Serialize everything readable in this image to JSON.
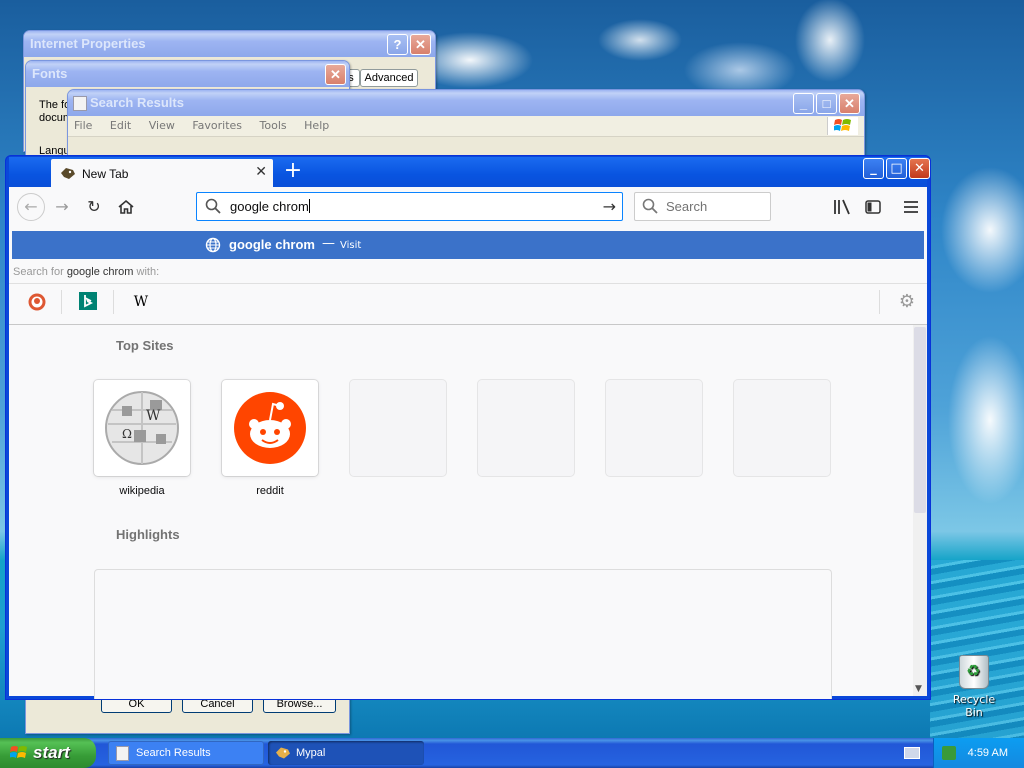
{
  "desktop": {
    "recycle_bin_label": "Recycle Bin"
  },
  "internet_properties": {
    "title": "Internet Properties",
    "tab_partial": "s",
    "tab_advanced": "Advanced"
  },
  "fonts_dialog": {
    "title": "Fonts",
    "text_line1": "The fo",
    "text_line2": "docum",
    "text_line3": "Langu",
    "ok_label": "OK",
    "cancel_label": "Cancel",
    "browse_label": "Browse..."
  },
  "search_results": {
    "title": "Search Results",
    "menu": [
      "File",
      "Edit",
      "View",
      "Favorites",
      "Tools",
      "Help"
    ]
  },
  "firefox": {
    "tab_title": "New Tab",
    "tab_close": "✕",
    "new_tab": "+",
    "url_value": "google chrom",
    "search_placeholder": "Search",
    "suggestion": {
      "title": "google chrom",
      "separator": "—",
      "action": "Visit"
    },
    "search_with_prefix": "Search for ",
    "search_with_query": "google chrom",
    "search_with_suffix": " with:",
    "engines": [
      "duckduckgo",
      "bing",
      "wikipedia"
    ],
    "wiki_glyph": "W",
    "top_sites_title": "Top Sites",
    "top_sites": [
      {
        "label": "wikipedia",
        "icon": "wikipedia-globe"
      },
      {
        "label": "reddit",
        "icon": "reddit-alien"
      }
    ],
    "highlights_title": "Highlights"
  },
  "taskbar": {
    "start_label": "start",
    "tasks": [
      {
        "label": "Search Results"
      },
      {
        "label": "Mypal"
      }
    ],
    "clock": "4:59 AM"
  },
  "colors": {
    "xp_blue": "#0a5ae8",
    "firefox_accent": "#0a84ff",
    "suggestion_highlight": "#3b72c9",
    "reddit": "#ff4500",
    "start_green": "#3c9a3c"
  }
}
